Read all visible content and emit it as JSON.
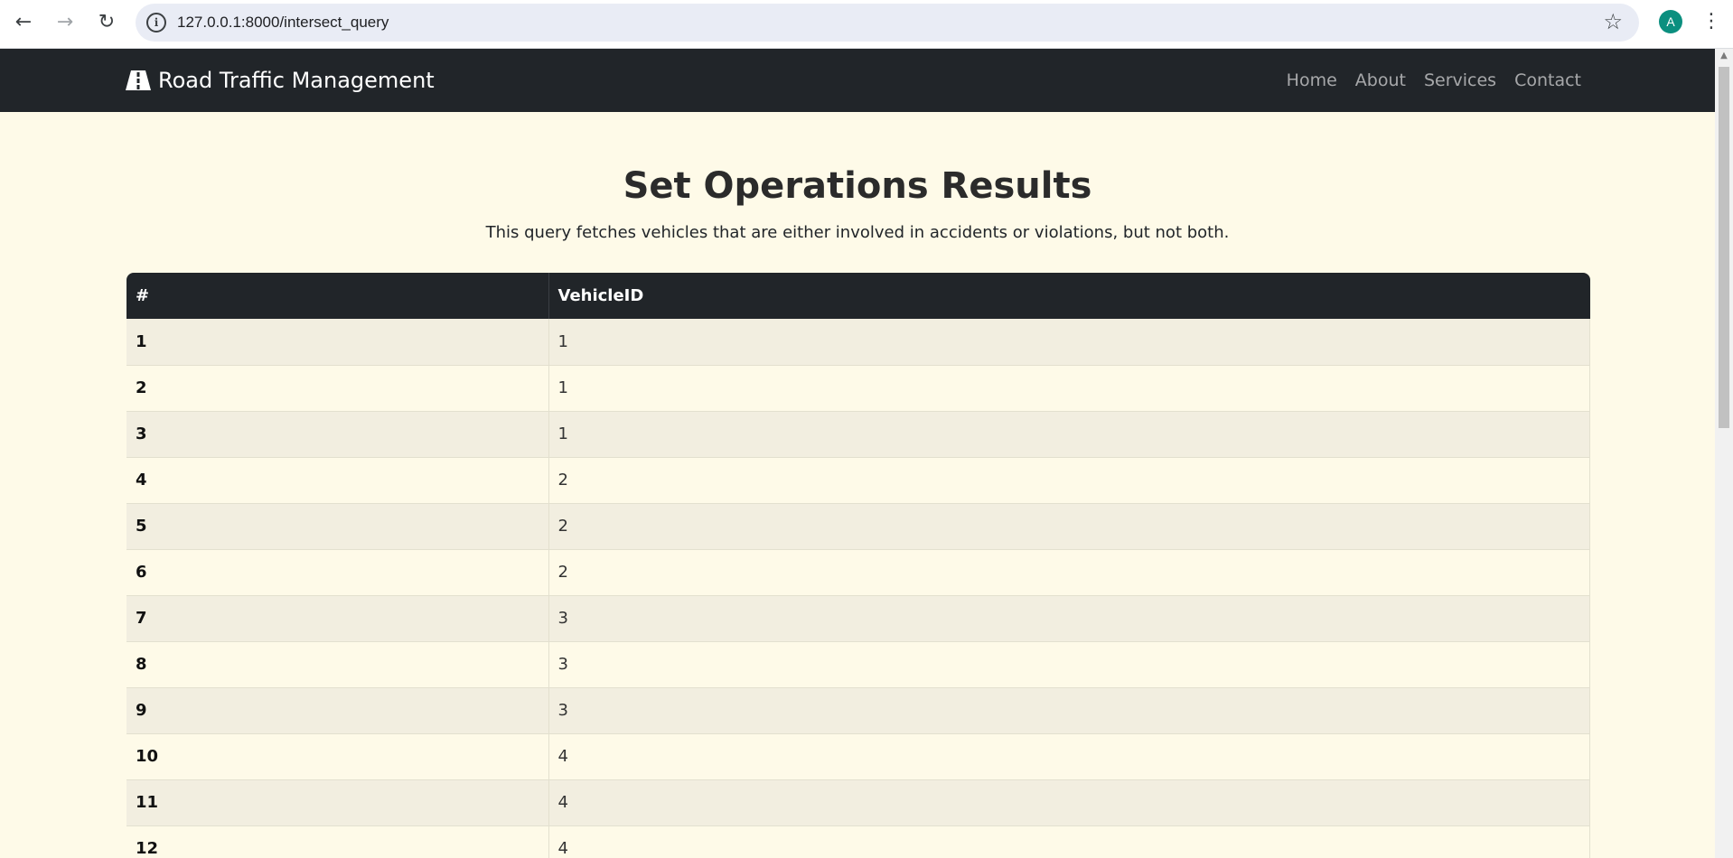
{
  "browser": {
    "url": "127.0.0.1:8000/intersect_query",
    "profile_initial": "A",
    "back_icon": "arrow-left-icon",
    "forward_icon": "arrow-right-icon",
    "reload_icon": "reload-icon",
    "bookmark_icon": "star-icon"
  },
  "navbar": {
    "brand": "Road Traffic Management",
    "links": [
      "Home",
      "About",
      "Services",
      "Contact"
    ],
    "background": "#212529"
  },
  "main": {
    "title": "Set Operations Results",
    "description": "This query fetches vehicles that are either involved in accidents or violations, but not both."
  },
  "table": {
    "headers": [
      "#",
      "VehicleID"
    ],
    "rows": [
      [
        "1",
        "1"
      ],
      [
        "2",
        "1"
      ],
      [
        "3",
        "1"
      ],
      [
        "4",
        "2"
      ],
      [
        "5",
        "2"
      ],
      [
        "6",
        "2"
      ],
      [
        "7",
        "3"
      ],
      [
        "8",
        "3"
      ],
      [
        "9",
        "3"
      ],
      [
        "10",
        "4"
      ],
      [
        "11",
        "4"
      ],
      [
        "12",
        "4"
      ]
    ]
  },
  "colors": {
    "page_background": "#fefae8",
    "row_stripe": "#f2eee0",
    "header_background": "#212529"
  }
}
